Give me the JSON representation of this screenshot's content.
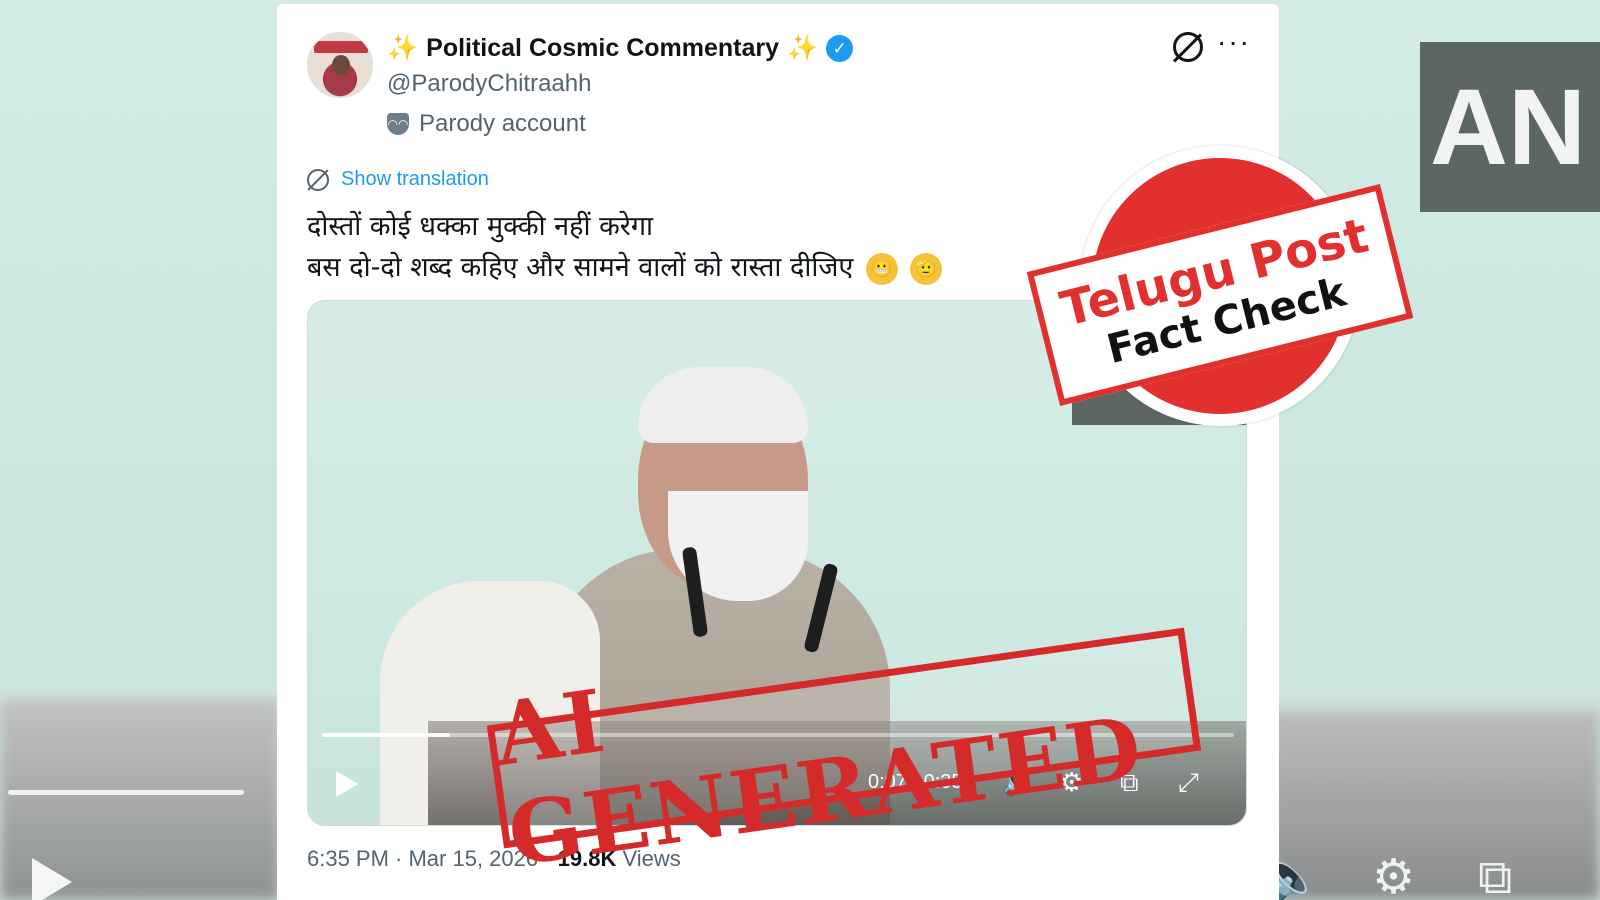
{
  "tweet": {
    "display_name": "Political Cosmic Commentary",
    "name_sparkle_icon": "sparkles-emoji",
    "verified_icon": "verified-badge-icon",
    "handle": "@ParodyChitraahh",
    "parody_label": "Parody account",
    "show_translation": "Show translation",
    "text_line_1": "दोस्तों कोई धक्का मुक्की नहीं करेगा",
    "text_line_2": "बस दो-दो शब्द कहिए और सामने वालों को रास्ता दीजिए",
    "emojis": [
      "grimacing-face-emoji",
      "saluting-face-emoji"
    ],
    "timestamp": "6:35 PM · Mar 15, 2026 · ",
    "views_count": "19.8K",
    "views_label": " Views"
  },
  "video": {
    "time_readout": "0:07 / 0:35",
    "progress": 0.14,
    "controls": [
      "play-icon",
      "volume-icon",
      "settings-gear-icon",
      "picture-in-picture-icon",
      "fullscreen-icon"
    ]
  },
  "overlays": {
    "ai_stamp": "AI GENERATED",
    "fact_check_seal": {
      "line1": "Telugu Post",
      "line2": "Fact Check"
    },
    "background_watermark": "AN"
  },
  "colors": {
    "stamp_red": "#d42a2a",
    "seal_red": "#e2302f",
    "link_blue": "#1d9bf0",
    "verified_blue": "#1d9bf0"
  }
}
